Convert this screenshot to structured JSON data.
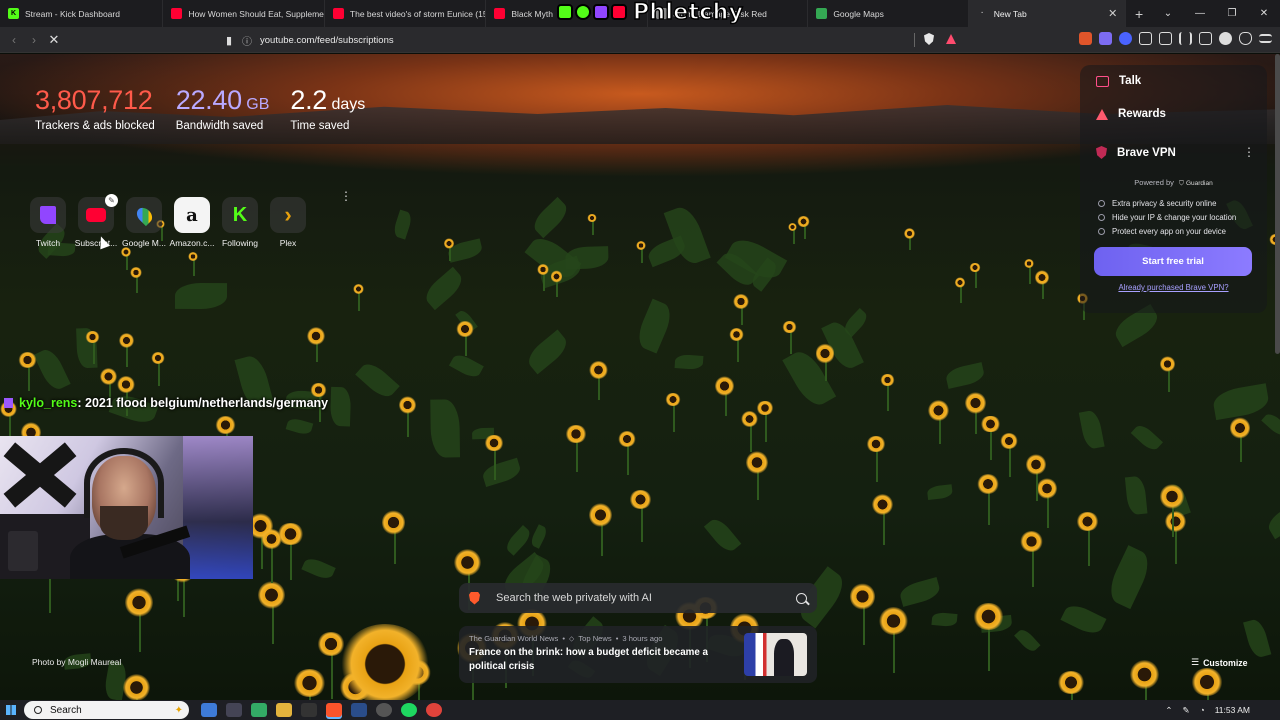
{
  "tabs": [
    {
      "title": "Stream - Kick Dashboard",
      "icon": "kick-icon",
      "color": "#53fc18"
    },
    {
      "title": "How Women Should Eat, Supplemen",
      "icon": "youtube-icon",
      "color": "#ff0033"
    },
    {
      "title": "The best video's of storm Eunice (15",
      "icon": "youtube-icon",
      "color": "#ff0033"
    },
    {
      "title": "Black Myth",
      "icon": "youtube-icon",
      "color": "#ff0033"
    },
    {
      "title": "Storm Damage Risk Red",
      "icon": "generic-icon",
      "color": "#888888"
    },
    {
      "title": "Google Maps",
      "icon": "maps-icon",
      "color": "#34a853"
    },
    {
      "title": "New Tab",
      "icon": "loading-icon",
      "color": "#cccccc"
    }
  ],
  "overlay_logo": "Phletchy",
  "address": {
    "url": "youtube.com/feed/subscriptions"
  },
  "stats": {
    "trackers": {
      "value": "3,807,712",
      "label": "Trackers & ads blocked"
    },
    "bandwidth": {
      "value": "22.40",
      "unit": "GB",
      "label": "Bandwidth saved"
    },
    "time": {
      "value": "2.2",
      "unit": "days",
      "label": "Time saved"
    }
  },
  "top_sites": [
    {
      "name": "Twitch",
      "icon": "twitch-icon",
      "color": "#9146ff"
    },
    {
      "name": "Subscript...",
      "icon": "youtube-icon",
      "color": "#ff0033"
    },
    {
      "name": "Google M...",
      "icon": "maps-icon",
      "color": "#34a853"
    },
    {
      "name": "Amazon.c...",
      "icon": "amazon-icon",
      "color": "#ffffff"
    },
    {
      "name": "Following",
      "icon": "kick-icon",
      "color": "#53fc18"
    },
    {
      "name": "Plex",
      "icon": "plex-icon",
      "color": "#e5a00d"
    }
  ],
  "chat": {
    "user": "kylo_rens",
    "message": ": 2021 flood belgium/netherlands/germany"
  },
  "panel": {
    "talk": "Talk",
    "rewards": "Rewards",
    "vpn_title": "Brave VPN",
    "powered_by": "Powered by",
    "partner": "Guardian",
    "features": [
      "Extra privacy & security online",
      "Hide your IP & change your location",
      "Protect every app on your device"
    ],
    "trial_button": "Start free trial",
    "purchased_link": "Already purchased Brave VPN?"
  },
  "search": {
    "placeholder": "Search the web privately with AI"
  },
  "news": {
    "source": "The Guardian World News",
    "category": "Top News",
    "age": "3 hours ago",
    "headline": "France on the brink: how a budget deficit became a political crisis"
  },
  "photo_credit": "Photo by Mogli Maureal",
  "customize_label": "Customize",
  "taskbar": {
    "search_label": "Search",
    "time": "11:53 AM"
  }
}
